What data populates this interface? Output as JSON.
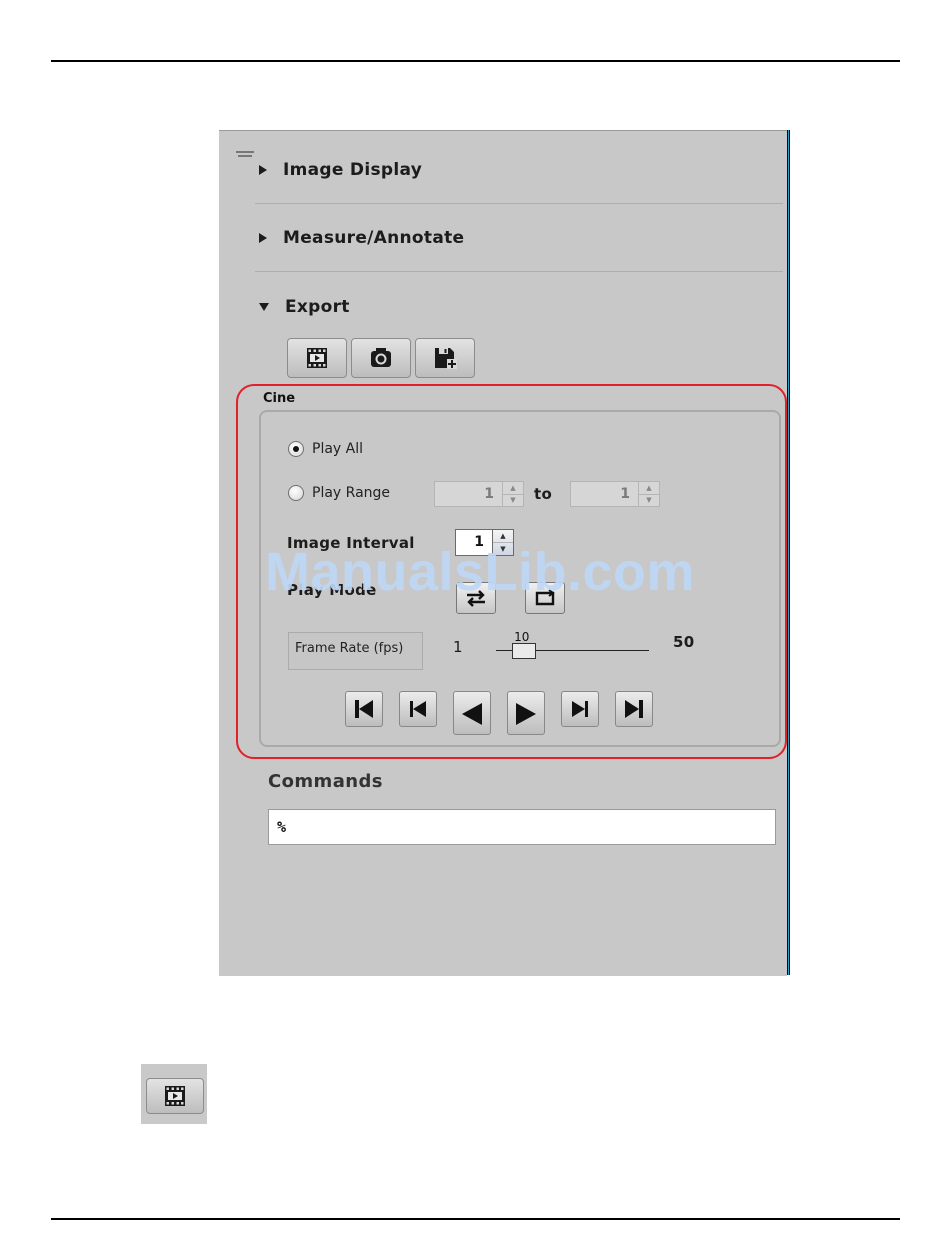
{
  "sections": {
    "image_display": "Image Display",
    "measure_annotate": "Measure/Annotate",
    "export": "Export"
  },
  "export_toolbar": {
    "buttons": [
      {
        "icon": "film-icon"
      },
      {
        "icon": "camera-icon"
      },
      {
        "icon": "save-plus-icon"
      }
    ]
  },
  "cine": {
    "title": "Cine",
    "play_all_label": "Play All",
    "play_range_label": "Play Range",
    "play_all_selected": true,
    "range_from": "1",
    "range_to_label": "to",
    "range_to": "1",
    "image_interval_label": "Image Interval",
    "image_interval_value": "1",
    "play_mode_label": "Play Mode",
    "frame_rate_label": "Frame Rate (fps)",
    "frame_rate_min": "1",
    "frame_rate_value": "10",
    "frame_rate_max": "50",
    "frame_rate_fraction": 0.184,
    "transport": [
      {
        "icon": "first-frame-icon"
      },
      {
        "icon": "previous-frame-icon"
      },
      {
        "icon": "play-reverse-icon"
      },
      {
        "icon": "play-icon"
      },
      {
        "icon": "next-frame-icon"
      },
      {
        "icon": "last-frame-icon"
      }
    ]
  },
  "commands": {
    "label": "Commands",
    "value": "%"
  },
  "watermark": "ManualsLib.com",
  "colors": {
    "panel": "#c8c8c8",
    "highlight": "#e0202a",
    "watermark": "#bed7f5"
  }
}
